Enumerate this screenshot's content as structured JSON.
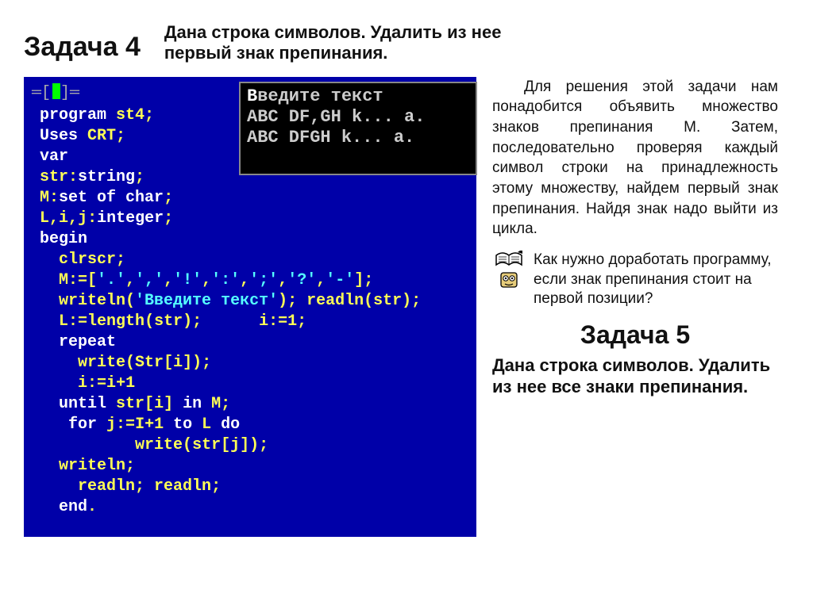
{
  "task4": {
    "title": "Задача 4",
    "prompt_line1": "Дана строка символов. Удалить из нее",
    "prompt_line2": "первый знак препинания."
  },
  "explain": {
    "text": "Для решения этой задачи нам понадобится объявить множество знаков препинания M. Затем, последовательно проверяя каждый символ строки на принадлежность этому множеству, найдем первый знак препинания. Найдя знак надо выйти из цикла."
  },
  "hint": {
    "text": "Как нужно доработать программу, если знак препинания стоит на первой позиции?"
  },
  "task5": {
    "title": "Задача 5",
    "prompt": "Дана строка символов. Удалить из нее все знаки препинания."
  },
  "code": {
    "border_tag": "═[",
    "border_tag2": "]═",
    "lines": [
      [
        [
          "kw",
          "program "
        ],
        [
          "id",
          "st4"
        ],
        [
          "sym",
          ";"
        ]
      ],
      [
        [
          "kw",
          "Uses "
        ],
        [
          "id",
          "CRT"
        ],
        [
          "sym",
          ";"
        ]
      ],
      [
        [
          "kw",
          "var"
        ]
      ],
      [
        [
          "id",
          "str"
        ],
        [
          "sym",
          ":"
        ],
        [
          "kw",
          "string"
        ],
        [
          "sym",
          ";"
        ]
      ],
      [
        [
          "id",
          "M"
        ],
        [
          "sym",
          ":"
        ],
        [
          "kw",
          "set of char"
        ],
        [
          "sym",
          ";"
        ]
      ],
      [
        [
          "id",
          "L"
        ],
        [
          "sym",
          ","
        ],
        [
          "id",
          "i"
        ],
        [
          "sym",
          ","
        ],
        [
          "id",
          "j"
        ],
        [
          "sym",
          ":"
        ],
        [
          "kw",
          "integer"
        ],
        [
          "sym",
          ";"
        ]
      ],
      [
        [
          "kw",
          "begin"
        ]
      ],
      [
        [
          "plain",
          "  "
        ],
        [
          "id",
          "clrscr"
        ],
        [
          "sym",
          ";"
        ]
      ],
      [
        [
          "plain",
          "  "
        ],
        [
          "id",
          "M"
        ],
        [
          "sym",
          ":=["
        ],
        [
          "str",
          "'.'"
        ],
        [
          "sym",
          ","
        ],
        [
          "str",
          "','"
        ],
        [
          "sym",
          ","
        ],
        [
          "str",
          "'!'"
        ],
        [
          "sym",
          ","
        ],
        [
          "str",
          "':'"
        ],
        [
          "sym",
          ","
        ],
        [
          "str",
          "';'"
        ],
        [
          "sym",
          ","
        ],
        [
          "str",
          "'?'"
        ],
        [
          "sym",
          ","
        ],
        [
          "str",
          "'-'"
        ],
        [
          "sym",
          "];"
        ]
      ],
      [
        [
          "plain",
          "  "
        ],
        [
          "id",
          "writeln"
        ],
        [
          "sym",
          "("
        ],
        [
          "str",
          "'Введите текст'"
        ],
        [
          "sym",
          "); "
        ],
        [
          "id",
          "readln"
        ],
        [
          "sym",
          "("
        ],
        [
          "id",
          "str"
        ],
        [
          "sym",
          ");"
        ]
      ],
      [
        [
          "plain",
          "  "
        ],
        [
          "id",
          "L"
        ],
        [
          "sym",
          ":="
        ],
        [
          "id",
          "length"
        ],
        [
          "sym",
          "("
        ],
        [
          "id",
          "str"
        ],
        [
          "sym",
          ");      "
        ],
        [
          "id",
          "i"
        ],
        [
          "sym",
          ":="
        ],
        [
          "id",
          "1"
        ],
        [
          "sym",
          ";"
        ]
      ],
      [
        [
          "plain",
          "  "
        ],
        [
          "kw",
          "repeat"
        ]
      ],
      [
        [
          "plain",
          "    "
        ],
        [
          "id",
          "write"
        ],
        [
          "sym",
          "("
        ],
        [
          "id",
          "Str"
        ],
        [
          "sym",
          "["
        ],
        [
          "id",
          "i"
        ],
        [
          "sym",
          "]);"
        ]
      ],
      [
        [
          "plain",
          "    "
        ],
        [
          "id",
          "i"
        ],
        [
          "sym",
          ":="
        ],
        [
          "id",
          "i"
        ],
        [
          "sym",
          "+"
        ],
        [
          "id",
          "1"
        ]
      ],
      [
        [
          "plain",
          "  "
        ],
        [
          "kw",
          "until "
        ],
        [
          "id",
          "str"
        ],
        [
          "sym",
          "["
        ],
        [
          "id",
          "i"
        ],
        [
          "sym",
          "] "
        ],
        [
          "kw",
          "in "
        ],
        [
          "id",
          "M"
        ],
        [
          "sym",
          ";"
        ]
      ],
      [
        [
          "plain",
          "   "
        ],
        [
          "kw",
          "for "
        ],
        [
          "id",
          "j"
        ],
        [
          "sym",
          ":="
        ],
        [
          "id",
          "I"
        ],
        [
          "sym",
          "+"
        ],
        [
          "id",
          "1"
        ],
        [
          "kw",
          " to "
        ],
        [
          "id",
          "L"
        ],
        [
          "kw",
          " do"
        ]
      ],
      [
        [
          "plain",
          "          "
        ],
        [
          "id",
          "write"
        ],
        [
          "sym",
          "("
        ],
        [
          "id",
          "str"
        ],
        [
          "sym",
          "["
        ],
        [
          "id",
          "j"
        ],
        [
          "sym",
          "]);"
        ]
      ],
      [
        [
          "plain",
          "  "
        ],
        [
          "id",
          "writeln"
        ],
        [
          "sym",
          ";"
        ]
      ],
      [
        [
          "plain",
          "    "
        ],
        [
          "id",
          "readln"
        ],
        [
          "sym",
          "; "
        ],
        [
          "id",
          "readln"
        ],
        [
          "sym",
          ";"
        ]
      ],
      [
        [
          "plain",
          "  "
        ],
        [
          "kw",
          "end"
        ],
        [
          "sym",
          "."
        ]
      ]
    ]
  },
  "console": {
    "line1": "Введите текст",
    "line2": "ABC DF,GH k... a.",
    "line3": "ABC DFGH k... a."
  },
  "icons": {
    "book": "book-icon",
    "face": "face-icon"
  }
}
